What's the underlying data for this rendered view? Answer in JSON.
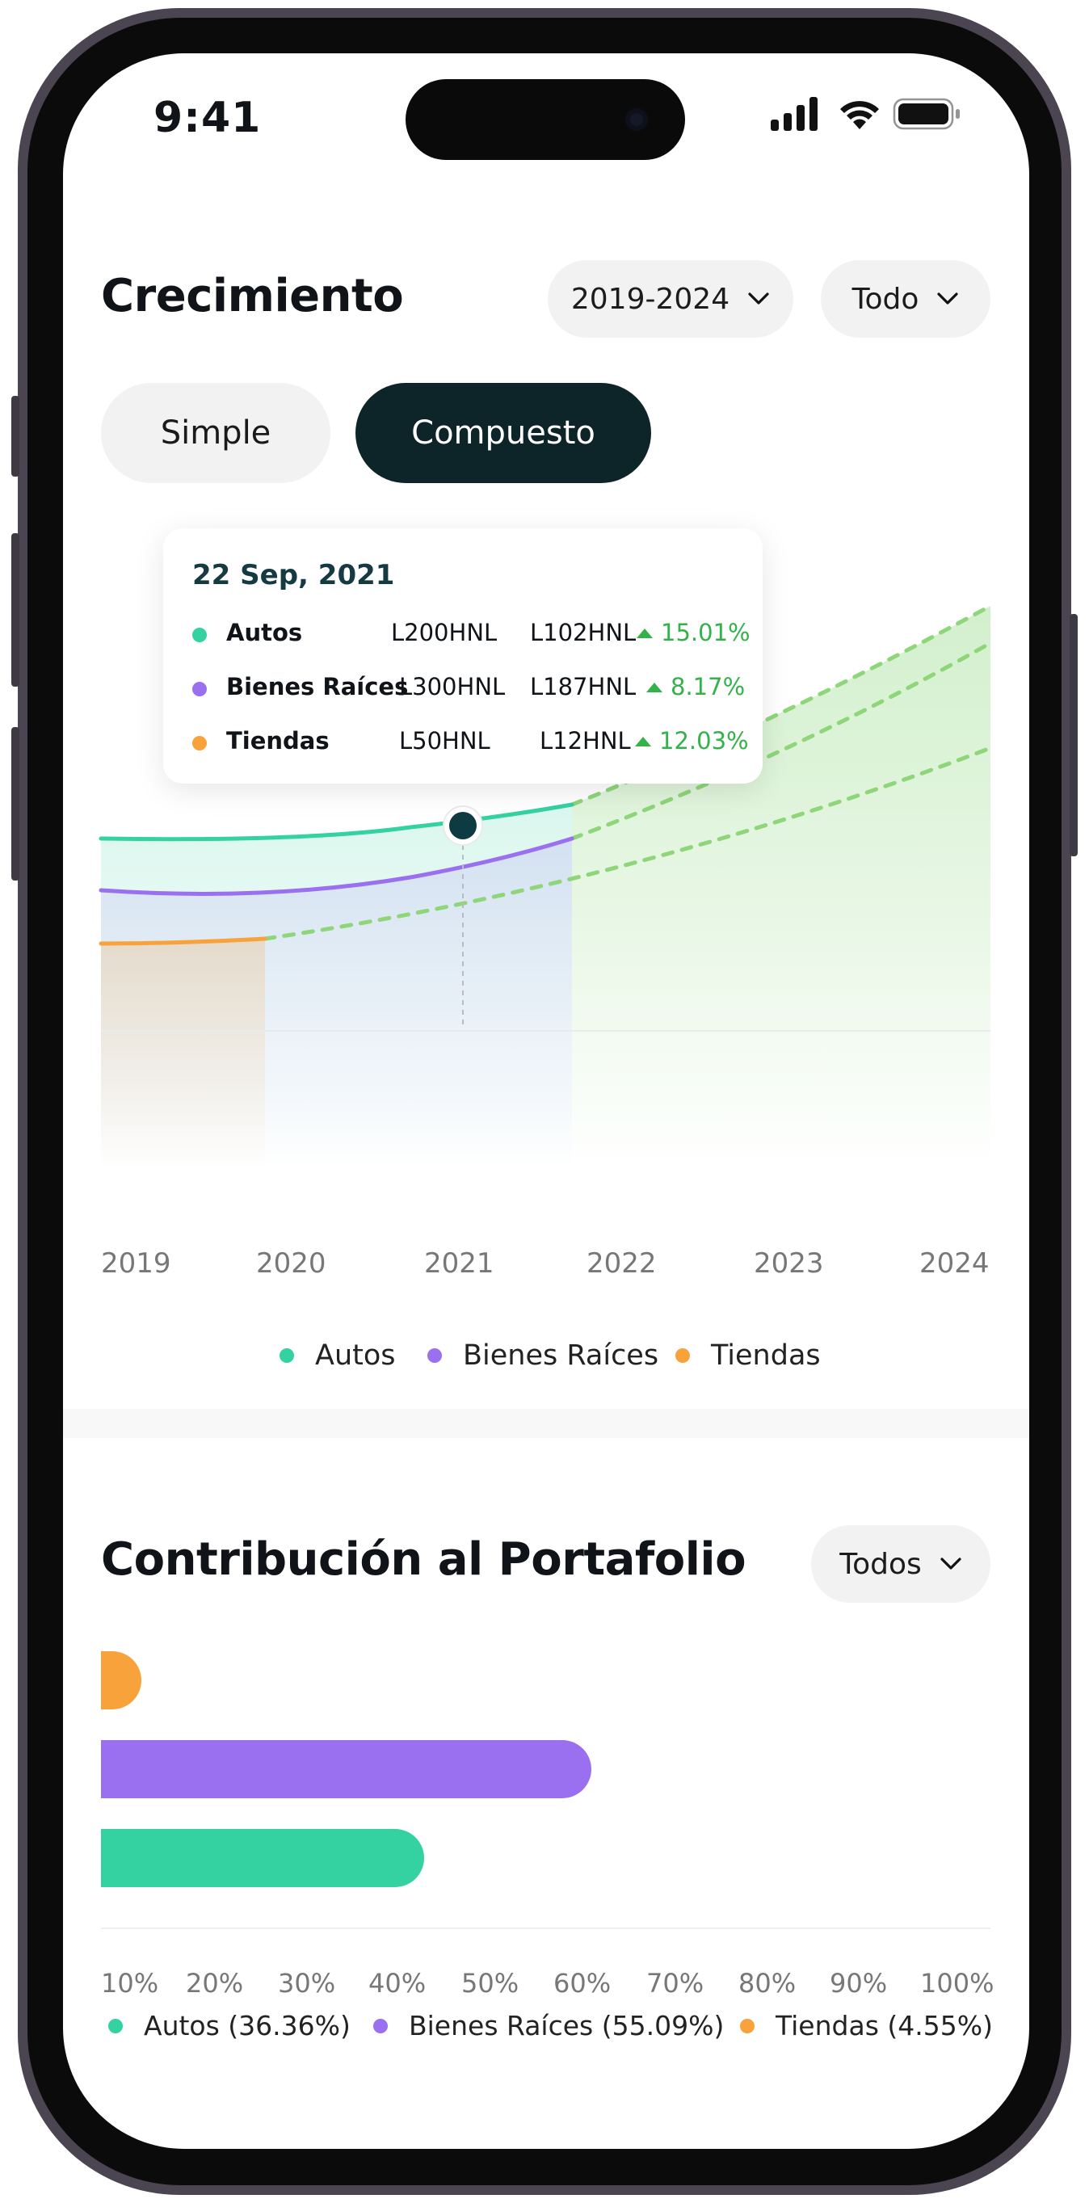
{
  "status_bar": {
    "time": "9:41"
  },
  "growth": {
    "title": "Crecimiento",
    "range_filter": "2019-2024",
    "category_filter": "Todo",
    "tabs": [
      {
        "label": "Simple",
        "active": false
      },
      {
        "label": "Compuesto",
        "active": true
      }
    ],
    "tooltip": {
      "date": "22 Sep, 2021",
      "rows": [
        {
          "name": "Autos",
          "value": "L200HNL",
          "gain": "L102HNL",
          "pct": "15.01%",
          "color": "#34d1a1"
        },
        {
          "name": "Bienes Raíces",
          "value": "L300HNL",
          "gain": "L187HNL",
          "pct": "8.17%",
          "color": "#9a6ff0"
        },
        {
          "name": "Tiendas",
          "value": "L50HNL",
          "gain": "L12HNL",
          "pct": "12.03%",
          "color": "#f7a23a"
        }
      ]
    },
    "legend": [
      {
        "label": "Autos",
        "color": "#34d1a1"
      },
      {
        "label": "Bienes Raíces",
        "color": "#9a6ff0"
      },
      {
        "label": "Tiendas",
        "color": "#f7a23a"
      }
    ]
  },
  "portfolio": {
    "title": "Contribución al Portafolio",
    "filter": "Todos",
    "legend": [
      {
        "label": "Autos (36.36%)",
        "color": "#34d1a1"
      },
      {
        "label": "Bienes Raíces (55.09%)",
        "color": "#9a6ff0"
      },
      {
        "label": "Tiendas (4.55%)",
        "color": "#f7a23a"
      }
    ]
  },
  "chart_data": [
    {
      "type": "line",
      "x": [
        "2019",
        "2020",
        "2021",
        "2022",
        "2023",
        "2024"
      ],
      "series": [
        {
          "name": "Autos",
          "color": "#34d1a1",
          "actual_until": "2021.75"
        },
        {
          "name": "Bienes Raíces",
          "color": "#9a6ff0",
          "actual_until": "2021.75"
        },
        {
          "name": "Tiendas",
          "color": "#f7a23a",
          "actual_until": "2019.95"
        }
      ],
      "projection_style": "dashed green",
      "highlight": {
        "date": "22 Sep, 2021"
      }
    },
    {
      "type": "bar",
      "orientation": "horizontal",
      "categories": [
        "Tiendas",
        "Bienes Raíces",
        "Autos"
      ],
      "values": [
        4.55,
        55.09,
        36.36
      ],
      "colors": [
        "#f7a23a",
        "#9a6ff0",
        "#34d1a1"
      ],
      "xticks": [
        "10%",
        "20%",
        "30%",
        "40%",
        "50%",
        "60%",
        "70%",
        "80%",
        "90%",
        "100%"
      ]
    }
  ]
}
